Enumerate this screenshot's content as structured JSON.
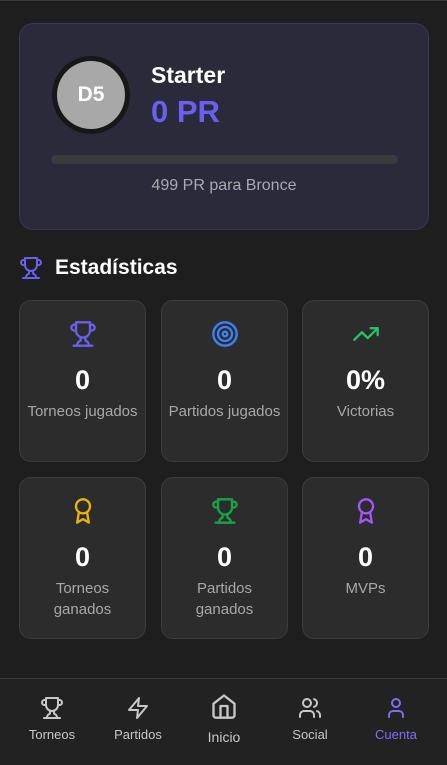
{
  "rank": {
    "division": "D5",
    "tier": "Starter",
    "points": "0 PR",
    "progress": 0,
    "next_rank_text": "499 PR para Bronce"
  },
  "stats": {
    "title": "Estadísticas",
    "cards": [
      {
        "icon": "trophy-icon",
        "value": "0",
        "label": "Torneos jugados",
        "color": "#6b5ff0"
      },
      {
        "icon": "target-icon",
        "value": "0",
        "label": "Partidos jugados",
        "color": "#3b82f6"
      },
      {
        "icon": "trending-up-icon",
        "value": "0%",
        "label": "Victorias",
        "color": "#22c55e"
      },
      {
        "icon": "medal-icon",
        "value": "0",
        "label": "Torneos ganados",
        "color": "#eab308"
      },
      {
        "icon": "trophy-icon",
        "value": "0",
        "label": "Partidos ganados",
        "color": "#16a34a"
      },
      {
        "icon": "medal-icon",
        "value": "0",
        "label": "MVPs",
        "color": "#a855f7"
      }
    ]
  },
  "nav": {
    "items": [
      {
        "icon": "trophy-icon",
        "label": "Torneos",
        "active": false
      },
      {
        "icon": "lightning-icon",
        "label": "Partidos",
        "active": false
      },
      {
        "icon": "home-icon",
        "label": "Inicio",
        "active": false
      },
      {
        "icon": "users-icon",
        "label": "Social",
        "active": false
      },
      {
        "icon": "user-icon",
        "label": "Cuenta",
        "active": true
      }
    ]
  },
  "colors": {
    "accent": "#6b5ff0",
    "background": "#1e1e1e",
    "card": "#2c2c2c"
  }
}
